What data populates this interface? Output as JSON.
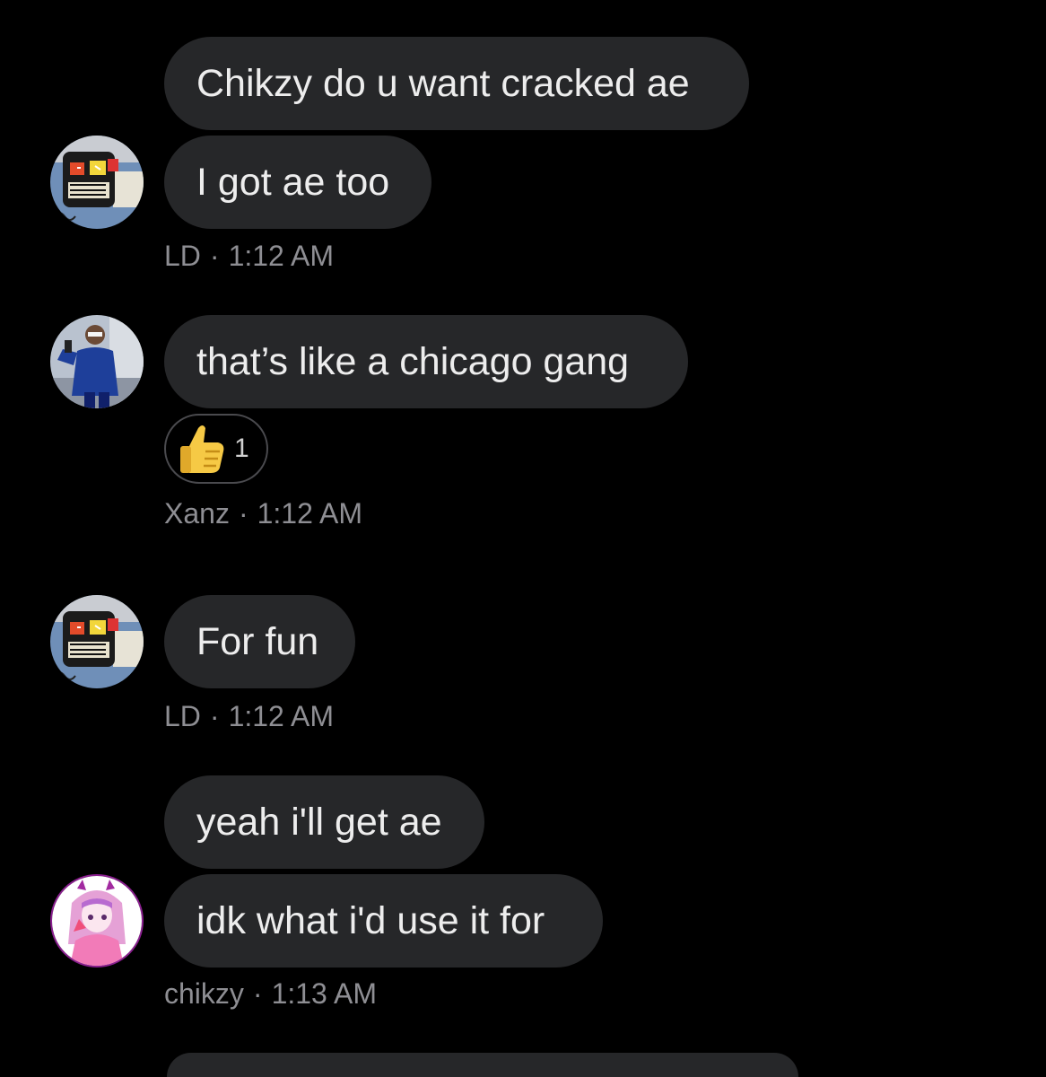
{
  "messages": [
    {
      "sender": "LD",
      "text": "Chikzy do u want cracked ae"
    },
    {
      "sender": "LD",
      "text": "I got ae too"
    },
    {
      "sender": "Xanz",
      "text": "that’s like a chicago gang"
    },
    {
      "sender": "LD",
      "text": "For fun"
    },
    {
      "sender": "chikzy",
      "text": "yeah i'll get ae"
    },
    {
      "sender": "chikzy",
      "text": "idk what i'd use it for"
    }
  ],
  "meta": [
    {
      "name": "LD",
      "time": "1:12 AM"
    },
    {
      "name": "Xanz",
      "time": "1:12 AM"
    },
    {
      "name": "LD",
      "time": "1:12 AM"
    },
    {
      "name": "chikzy",
      "time": "1:13 AM"
    }
  ],
  "separator": "·",
  "reaction": {
    "emoji": "thumbs-up-icon",
    "count": "1"
  },
  "avatars": [
    {
      "user": "LD",
      "icon": "basquiat-skull-avatar-icon"
    },
    {
      "user": "Xanz",
      "icon": "selfie-person-avatar-icon"
    },
    {
      "user": "LD",
      "icon": "basquiat-skull-avatar-icon"
    },
    {
      "user": "chikzy",
      "icon": "anime-girl-avatar-icon"
    }
  ],
  "colors": {
    "background": "#000000",
    "bubble": "#262729",
    "bubble_text": "#ededed",
    "meta_text": "#8e8e93"
  }
}
